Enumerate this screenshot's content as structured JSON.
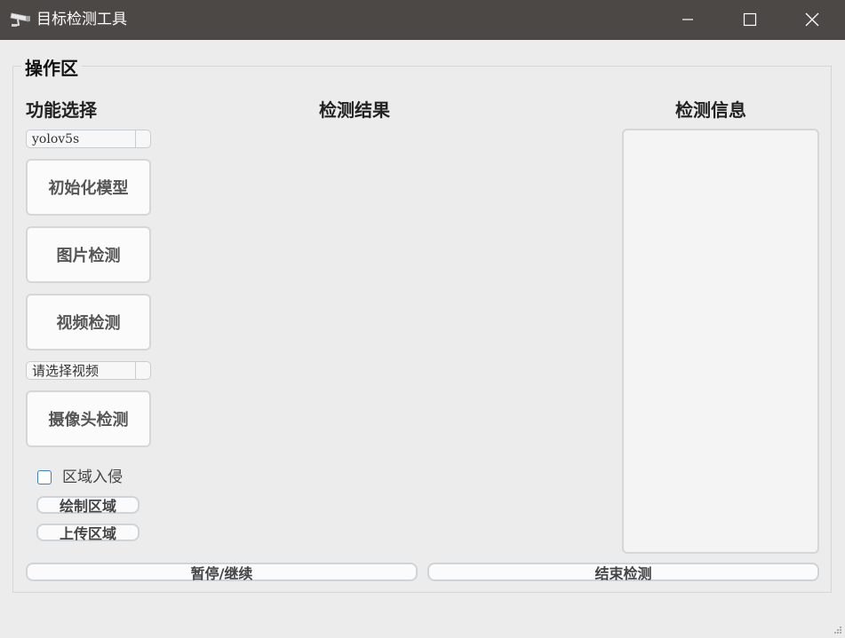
{
  "window": {
    "title": "目标检测工具",
    "app_icon": "security-camera-icon",
    "controls": [
      "minimize-icon",
      "maximize-icon",
      "close-icon"
    ]
  },
  "group": {
    "title": "操作区"
  },
  "labels": {
    "function_select": "功能选择",
    "detect_result": "检测结果",
    "detect_info": "检测信息"
  },
  "model_select": {
    "value": "yolov5s"
  },
  "buttons": {
    "init_model": "初始化模型",
    "image_detect": "图片检测",
    "video_detect": "视频检测",
    "camera_detect": "摄像头检测",
    "draw_area": "绘制区域",
    "upload_area": "上传区域",
    "pause_resume": "暂停/继续",
    "stop_detect": "结束检测"
  },
  "video_select": {
    "value": "请选择视频"
  },
  "intrusion": {
    "label": "区域入侵",
    "checked": false
  },
  "info_panel": {
    "text": ""
  },
  "colors": {
    "titlebar": "#4b4846",
    "background": "#ececec",
    "checkbox_border": "#3b80c9"
  }
}
